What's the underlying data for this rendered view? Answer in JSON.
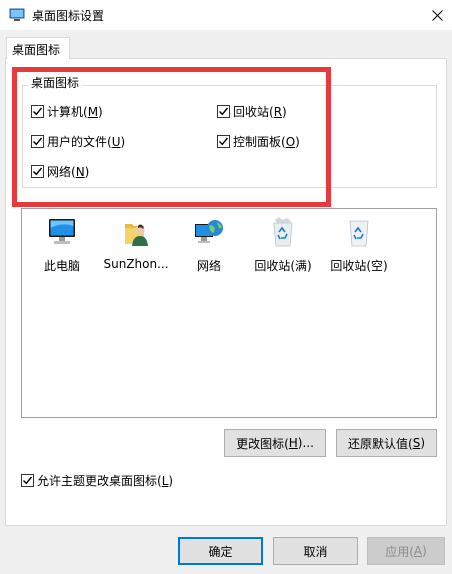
{
  "window": {
    "title": "桌面图标设置"
  },
  "tabs": [
    {
      "label": "桌面图标"
    }
  ],
  "group": {
    "title": "桌面图标",
    "checkboxes": [
      {
        "label": "计算机(",
        "key": "M",
        "suffix": ")",
        "checked": true
      },
      {
        "label": "回收站(",
        "key": "R",
        "suffix": ")",
        "checked": true
      },
      {
        "label": "用户的文件(",
        "key": "U",
        "suffix": ")",
        "checked": true
      },
      {
        "label": "控制面板(",
        "key": "O",
        "suffix": ")",
        "checked": true
      },
      {
        "label": "网络(",
        "key": "N",
        "suffix": ")",
        "checked": true
      }
    ]
  },
  "icons": [
    {
      "label": "此电脑",
      "icon": "computer-icon"
    },
    {
      "label": "SunZhon...",
      "icon": "user-folder-icon"
    },
    {
      "label": "网络",
      "icon": "network-icon"
    },
    {
      "label": "回收站(满)",
      "icon": "recycle-bin-full-icon"
    },
    {
      "label": "回收站(空)",
      "icon": "recycle-bin-empty-icon"
    }
  ],
  "actions": {
    "change_icon": {
      "label": "更改图标(",
      "key": "H",
      "suffix": ")..."
    },
    "restore_default": {
      "label": "还原默认值(",
      "key": "S",
      "suffix": ")"
    }
  },
  "allow_themes": {
    "label": "允许主题更改桌面图标(",
    "key": "L",
    "suffix": ")",
    "checked": true
  },
  "footer": {
    "ok": "确定",
    "cancel": "取消",
    "apply": {
      "label": "应用(",
      "key": "A",
      "suffix": ")"
    }
  },
  "colors": {
    "highlight": "#e8393c",
    "accent": "#0078d7"
  }
}
